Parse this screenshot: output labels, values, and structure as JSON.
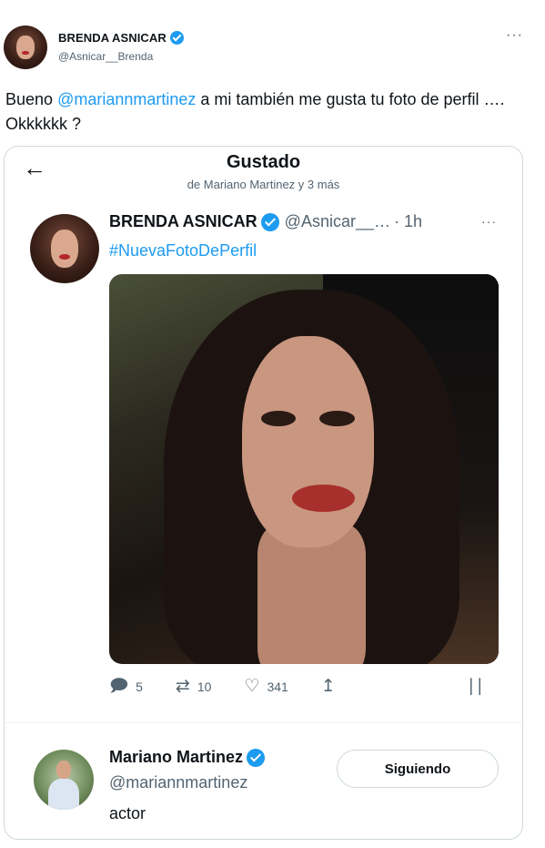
{
  "outer_tweet": {
    "author_name": "BRENDA ASNICAR",
    "author_handle": "@Asnicar__Brenda",
    "more_icon": "more-dots-icon",
    "text_before": "Bueno ",
    "mention": "@mariannmartinez",
    "text_after": " a mi también me gusta tu foto de perfil …. Okkkkkk ?"
  },
  "card": {
    "back_icon": "back-arrow-icon",
    "title": "Gustado",
    "subtitle": "de Mariano Martinez y 3 más",
    "tweet": {
      "author_name": "BRENDA ASNICAR",
      "author_handle": "@Asnicar__…",
      "time": "· 1h",
      "more_icon": "more-dots-icon",
      "hashtag": "#NuevaFotoDePerfil",
      "actions": {
        "replies": "5",
        "retweets": "10",
        "likes": "341"
      }
    },
    "profile": {
      "name": "Mariano Martinez",
      "handle": "@mariannmartinez",
      "bio": "actor",
      "follow_label": "Siguiendo"
    }
  },
  "colors": {
    "accent": "#1d9bf0",
    "text": "#0f1419",
    "muted": "#536471",
    "border": "#cfd9de"
  }
}
